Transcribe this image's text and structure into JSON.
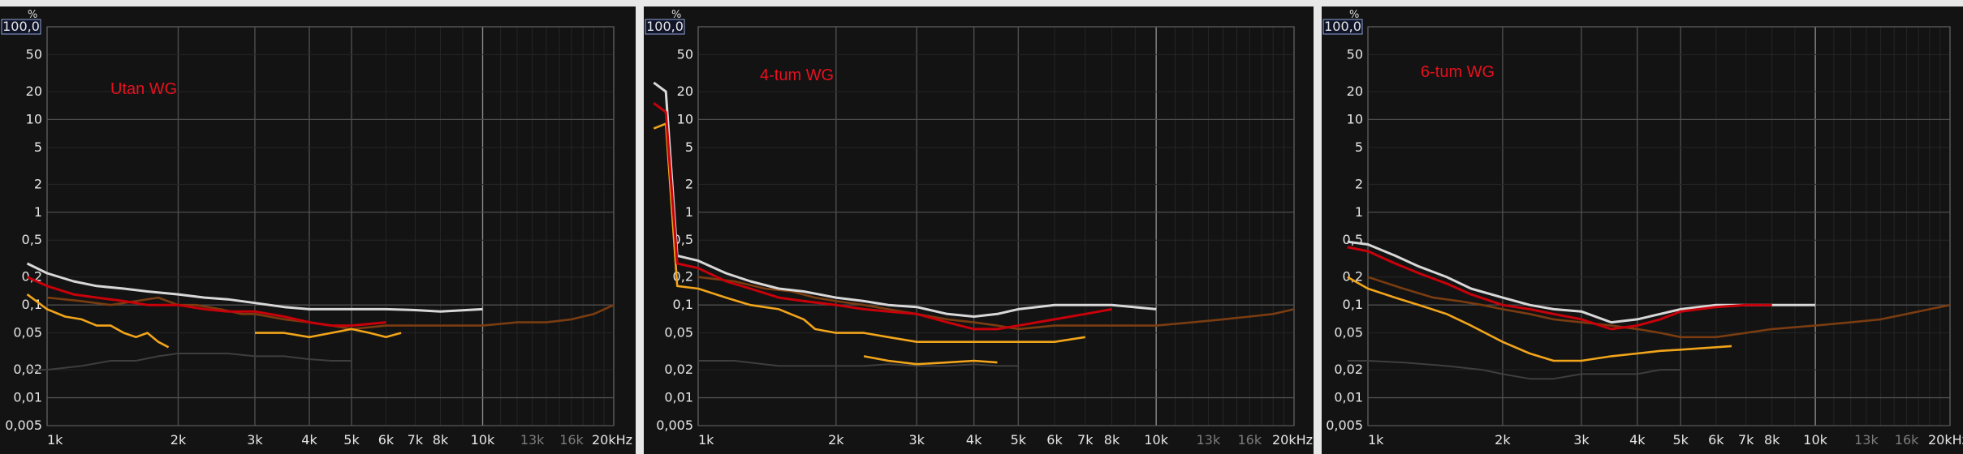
{
  "colors": {
    "background": "#131313",
    "grid_major": "#4e4e4e",
    "grid_minor": "#262626",
    "divider": "#e8e8e8",
    "fundamental": "#d8d8d8",
    "thd": "#c8000a",
    "h2": "#7a3c10",
    "h3": "#f2a51a",
    "h4": "#3e3e3e"
  },
  "axes": {
    "y_unit": "%",
    "y_top_label": "100,0",
    "y_ticks": [
      "50",
      "20",
      "10",
      "5",
      "2",
      "1",
      "0,5",
      "0,2",
      "0,1",
      "0,05",
      "0,02",
      "0,01",
      "0,005"
    ],
    "y_values": [
      50,
      20,
      10,
      5,
      2,
      1,
      0.5,
      0.2,
      0.1,
      0.05,
      0.02,
      0.01,
      0.005
    ],
    "y_range": [
      0.005,
      100
    ],
    "y_scale": "log",
    "x_ticks": [
      "1k",
      "2k",
      "3k",
      "4k",
      "5k",
      "6k",
      "7k",
      "8k",
      "10k",
      "13k",
      "16k",
      "20kHz"
    ],
    "x_values": [
      1000,
      2000,
      3000,
      4000,
      5000,
      6000,
      7000,
      8000,
      10000,
      13000,
      16000,
      20000
    ],
    "x_range": [
      1000,
      20000
    ],
    "x_scale": "log",
    "grid": true
  },
  "chart_data": [
    {
      "type": "line",
      "title": "Utan WG",
      "series": [
        {
          "color_key": "fundamental",
          "x": [
            900,
            1000,
            1150,
            1300,
            1500,
            1700,
            2000,
            2300,
            2600,
            3000,
            3500,
            4000,
            4500,
            5000,
            6000,
            7000,
            8000,
            10000
          ],
          "y": [
            0.28,
            0.22,
            0.18,
            0.16,
            0.15,
            0.14,
            0.13,
            0.12,
            0.115,
            0.105,
            0.095,
            0.09,
            0.09,
            0.09,
            0.09,
            0.088,
            0.085,
            0.09
          ]
        },
        {
          "color_key": "thd",
          "x": [
            900,
            1000,
            1150,
            1300,
            1500,
            1700,
            2000,
            2300,
            2600,
            3000,
            3500,
            4000,
            4500,
            5000,
            6000
          ],
          "y": [
            0.2,
            0.16,
            0.13,
            0.12,
            0.11,
            0.1,
            0.1,
            0.09,
            0.085,
            0.085,
            0.075,
            0.065,
            0.06,
            0.06,
            0.065
          ]
        },
        {
          "color_key": "h2",
          "x": [
            1000,
            1200,
            1400,
            1600,
            1800,
            2000,
            2200,
            2500,
            2800,
            3000,
            3500,
            4000,
            4500,
            5000,
            6000,
            7000,
            8000,
            10000,
            12000,
            14000,
            16000,
            18000,
            20000
          ],
          "y": [
            0.12,
            0.11,
            0.1,
            0.11,
            0.12,
            0.1,
            0.1,
            0.09,
            0.08,
            0.08,
            0.07,
            0.065,
            0.06,
            0.055,
            0.06,
            0.06,
            0.06,
            0.06,
            0.065,
            0.065,
            0.07,
            0.08,
            0.1
          ]
        },
        {
          "color_key": "h3",
          "x": [
            900,
            1000,
            1100,
            1200,
            1300,
            1400,
            1500,
            1600,
            1700,
            1800,
            1900
          ],
          "y": [
            0.13,
            0.09,
            0.075,
            0.07,
            0.06,
            0.06,
            0.05,
            0.045,
            0.05,
            0.04,
            0.035
          ]
        },
        {
          "color_key": "h3",
          "x": [
            3000,
            3500,
            4000,
            4500,
            5000,
            5500,
            6000,
            6500
          ],
          "y": [
            0.05,
            0.05,
            0.045,
            0.05,
            0.055,
            0.05,
            0.045,
            0.05
          ]
        },
        {
          "color_key": "h4",
          "x": [
            900,
            1000,
            1200,
            1400,
            1600,
            1800,
            2000,
            2300,
            2600,
            3000,
            3500,
            4000,
            4500,
            5000
          ],
          "y": [
            0.02,
            0.02,
            0.022,
            0.025,
            0.025,
            0.028,
            0.03,
            0.03,
            0.03,
            0.028,
            0.028,
            0.026,
            0.025,
            0.025
          ]
        }
      ]
    },
    {
      "type": "line",
      "title": "4-tum WG",
      "series": [
        {
          "color_key": "fundamental",
          "x": [
            800,
            850,
            900,
            1000,
            1150,
            1300,
            1500,
            1700,
            2000,
            2300,
            2600,
            3000,
            3500,
            4000,
            4500,
            5000,
            6000,
            7000,
            8000,
            10000
          ],
          "y": [
            25,
            20,
            0.34,
            0.3,
            0.22,
            0.18,
            0.15,
            0.14,
            0.12,
            0.11,
            0.1,
            0.095,
            0.08,
            0.075,
            0.08,
            0.09,
            0.1,
            0.1,
            0.1,
            0.09
          ]
        },
        {
          "color_key": "thd",
          "x": [
            800,
            850,
            900,
            1000,
            1150,
            1300,
            1500,
            1700,
            2000,
            2300,
            2600,
            3000,
            3500,
            4000,
            4500,
            5000,
            6000,
            7000,
            8000
          ],
          "y": [
            15,
            12,
            0.28,
            0.25,
            0.18,
            0.15,
            0.12,
            0.11,
            0.1,
            0.09,
            0.085,
            0.08,
            0.065,
            0.055,
            0.055,
            0.06,
            0.07,
            0.08,
            0.09
          ]
        },
        {
          "color_key": "h2",
          "x": [
            1000,
            1200,
            1400,
            1600,
            1800,
            2000,
            2300,
            2600,
            3000,
            3500,
            4000,
            4500,
            5000,
            6000,
            7000,
            8000,
            10000,
            12000,
            14000,
            16000,
            18000,
            20000
          ],
          "y": [
            0.2,
            0.18,
            0.15,
            0.14,
            0.12,
            0.11,
            0.1,
            0.09,
            0.08,
            0.07,
            0.065,
            0.06,
            0.055,
            0.06,
            0.06,
            0.06,
            0.06,
            0.065,
            0.07,
            0.075,
            0.08,
            0.09
          ]
        },
        {
          "color_key": "h3",
          "x": [
            800,
            850,
            900,
            1000,
            1150,
            1300,
            1500,
            1700,
            1800,
            2000,
            2300,
            2600,
            3000,
            3500,
            4000,
            4500,
            5000,
            6000,
            7000
          ],
          "y": [
            8,
            9,
            0.16,
            0.15,
            0.12,
            0.1,
            0.09,
            0.07,
            0.055,
            0.05,
            0.05,
            0.045,
            0.04,
            0.04,
            0.04,
            0.04,
            0.04,
            0.04,
            0.045
          ]
        },
        {
          "color_key": "h3",
          "x": [
            2300,
            2600,
            3000,
            3500,
            4000,
            4500
          ],
          "y": [
            0.028,
            0.025,
            0.023,
            0.024,
            0.025,
            0.024
          ]
        },
        {
          "color_key": "h4",
          "x": [
            1000,
            1200,
            1500,
            1800,
            2000,
            2300,
            2600,
            3000,
            3500,
            4000,
            4500,
            5000
          ],
          "y": [
            0.025,
            0.025,
            0.022,
            0.022,
            0.022,
            0.022,
            0.023,
            0.022,
            0.022,
            0.023,
            0.022,
            0.022
          ]
        }
      ]
    },
    {
      "type": "line",
      "title": "6-tum WG",
      "series": [
        {
          "color_key": "fundamental",
          "x": [
            900,
            1000,
            1150,
            1300,
            1500,
            1700,
            2000,
            2300,
            2600,
            3000,
            3500,
            4000,
            4500,
            5000,
            6000,
            7000,
            8000,
            10000
          ],
          "y": [
            0.48,
            0.45,
            0.34,
            0.26,
            0.2,
            0.15,
            0.12,
            0.1,
            0.09,
            0.085,
            0.065,
            0.07,
            0.08,
            0.09,
            0.1,
            0.1,
            0.1,
            0.1
          ]
        },
        {
          "color_key": "thd",
          "x": [
            900,
            1000,
            1150,
            1300,
            1500,
            1700,
            2000,
            2300,
            2600,
            3000,
            3500,
            4000,
            4500,
            5000,
            6000,
            7000,
            8000
          ],
          "y": [
            0.42,
            0.38,
            0.28,
            0.22,
            0.17,
            0.13,
            0.1,
            0.09,
            0.08,
            0.07,
            0.055,
            0.06,
            0.07,
            0.085,
            0.095,
            0.1,
            0.1
          ]
        },
        {
          "color_key": "h2",
          "x": [
            1000,
            1200,
            1400,
            1600,
            1800,
            2000,
            2300,
            2600,
            3000,
            3500,
            4000,
            4500,
            5000,
            6000,
            7000,
            8000,
            10000,
            12000,
            14000,
            16000,
            18000,
            20000
          ],
          "y": [
            0.2,
            0.15,
            0.12,
            0.11,
            0.1,
            0.09,
            0.08,
            0.07,
            0.065,
            0.06,
            0.055,
            0.05,
            0.045,
            0.045,
            0.05,
            0.055,
            0.06,
            0.065,
            0.07,
            0.08,
            0.09,
            0.1
          ]
        },
        {
          "color_key": "h3",
          "x": [
            900,
            1000,
            1150,
            1300,
            1500,
            1700,
            2000,
            2300,
            2600,
            3000,
            3500,
            4000,
            4500,
            5000,
            6000,
            6500
          ],
          "y": [
            0.2,
            0.15,
            0.12,
            0.1,
            0.08,
            0.06,
            0.04,
            0.03,
            0.025,
            0.025,
            0.028,
            0.03,
            0.032,
            0.033,
            0.035,
            0.036
          ]
        },
        {
          "color_key": "h4",
          "x": [
            900,
            1000,
            1200,
            1500,
            1800,
            2000,
            2300,
            2600,
            3000,
            3500,
            4000,
            4500,
            5000
          ],
          "y": [
            0.025,
            0.025,
            0.024,
            0.022,
            0.02,
            0.018,
            0.016,
            0.016,
            0.018,
            0.018,
            0.018,
            0.02,
            0.02
          ]
        }
      ]
    }
  ]
}
